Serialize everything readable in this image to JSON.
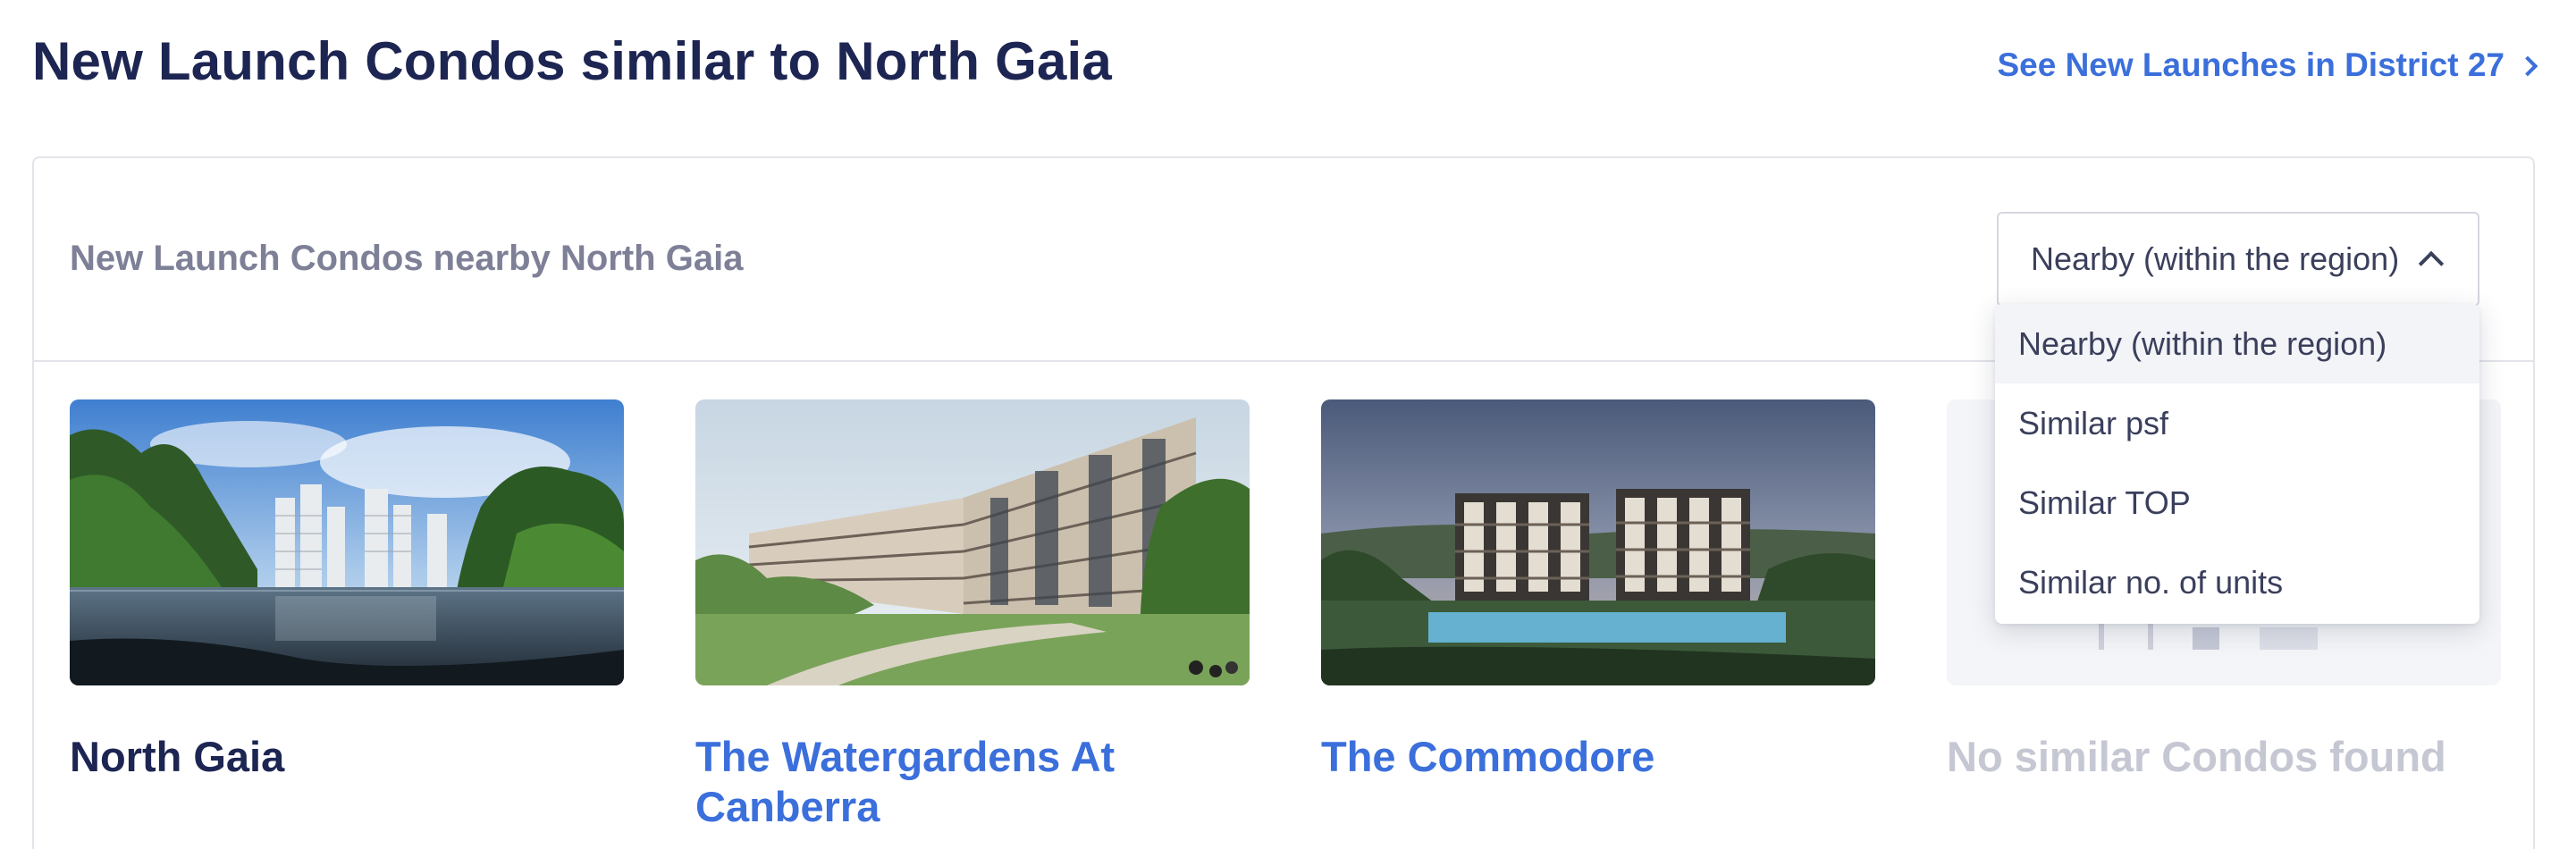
{
  "header": {
    "title": "New Launch Condos similar to North Gaia",
    "see_link": "See New Launches in District 27"
  },
  "panel": {
    "subtitle": "New Launch Condos nearby North Gaia",
    "filter": {
      "selected": "Nearby (within the region)",
      "options": [
        "Nearby (within the region)",
        "Similar psf",
        "Similar TOP",
        "Similar no. of units"
      ]
    }
  },
  "cards": [
    {
      "name": "North Gaia",
      "style": "current"
    },
    {
      "name": "The Watergardens At Canberra",
      "style": "link"
    },
    {
      "name": "The Commodore",
      "style": "link"
    },
    {
      "name": "No similar Condos found",
      "style": "empty"
    }
  ],
  "colors": {
    "title": "#1d2552",
    "link": "#3b6fdb",
    "muted_text": "#7d8096",
    "empty_text": "#c5c7d2",
    "border": "#e2e4ea"
  }
}
